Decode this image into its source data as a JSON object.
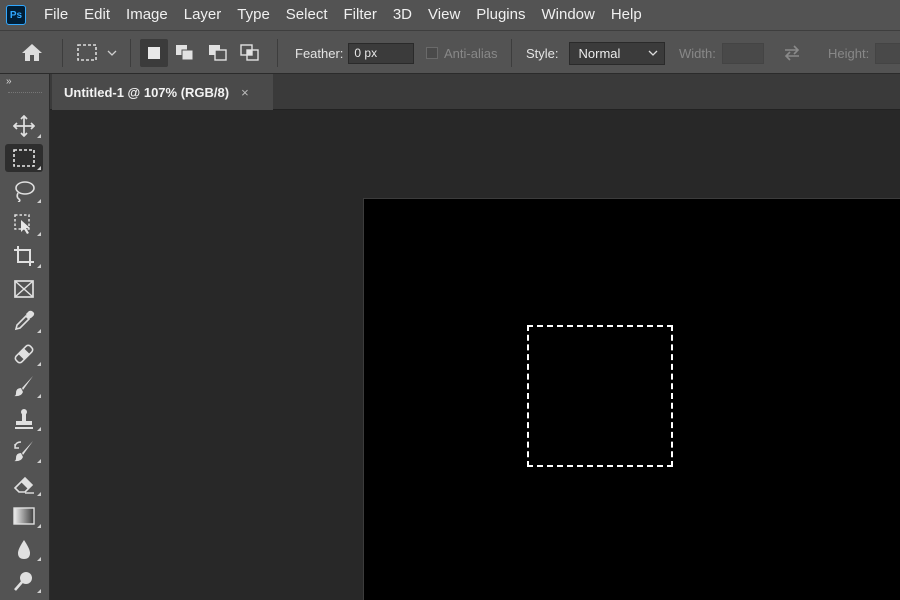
{
  "app": {
    "logo_text": "Ps"
  },
  "menu": [
    "File",
    "Edit",
    "Image",
    "Layer",
    "Type",
    "Select",
    "Filter",
    "3D",
    "View",
    "Plugins",
    "Window",
    "Help"
  ],
  "options": {
    "home_icon": "home-icon",
    "tool_preset_icon": "rectangular-marquee-icon",
    "selection_modes": [
      "new-selection",
      "add-to-selection",
      "subtract-from-selection",
      "intersect-with-selection"
    ],
    "feather_label": "Feather:",
    "feather_value": "0 px",
    "antialias_label": "Anti-alias",
    "style_label": "Style:",
    "style_value": "Normal",
    "width_label": "Width:",
    "width_value": "",
    "height_label": "Height:",
    "height_value": ""
  },
  "document_tab": {
    "title": "Untitled-1 @ 107% (RGB/8)",
    "close": "×"
  },
  "toolbar": {
    "collapse": "»",
    "tools": [
      "move",
      "rectangular-marquee",
      "lasso",
      "object-selection",
      "crop",
      "frame",
      "eyedropper",
      "spot-healing-brush",
      "brush",
      "clone-stamp",
      "history-brush",
      "eraser",
      "gradient",
      "blur",
      "dodge"
    ],
    "active_tool": "rectangular-marquee"
  },
  "canvas": {
    "background": "#000000",
    "selection": "rectangle"
  }
}
